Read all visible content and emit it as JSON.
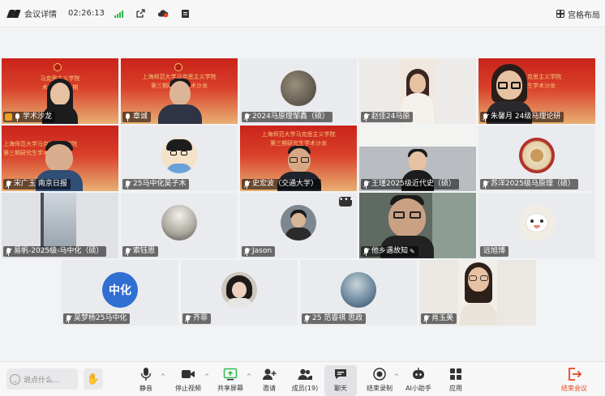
{
  "topbar": {
    "app_label": "会议详情",
    "timer": "02:26:13",
    "layout_label": "宫格布局"
  },
  "banner": {
    "lines": [
      "上海师范大学马克思主义学院",
      "第三期研究生学术沙龙"
    ],
    "fragment_1": [
      "马克思主义学院",
      "术沙龙(第三期"
    ],
    "fragment_4": [
      "克思主义学院",
      "生学术沙龙"
    ]
  },
  "participants": [
    {
      "name": "学术沙龙",
      "mic": "on",
      "host": true
    },
    {
      "name": "章诚",
      "mic": "on"
    },
    {
      "name": "2024马原理邹鑫（硕）",
      "mic": "off"
    },
    {
      "name": "赵佳24马原",
      "mic": "off"
    },
    {
      "name": "朱馨月 24级马理论研",
      "mic": "off"
    },
    {
      "name": "宋广玉 南京日报",
      "mic": "off"
    },
    {
      "name": "25马中化吴子木",
      "mic": "off"
    },
    {
      "name": "史宏波（交通大学）",
      "mic": "off"
    },
    {
      "name": "王瑾2025级近代史（硕）",
      "mic": "off"
    },
    {
      "name": "苏洋2025级马原理（硕）",
      "mic": "off"
    },
    {
      "name": "易帆-2025级-马中化（硕）",
      "mic": "off"
    },
    {
      "name": "索钰恩",
      "mic": "off"
    },
    {
      "name": "Jason",
      "mic": "off"
    },
    {
      "name": "他乡遇故知",
      "mic": "off"
    },
    {
      "name": "远旭博",
      "mic": "none"
    },
    {
      "name": "吴梦杨25马中化",
      "mic": "off",
      "avatar_text": "中化"
    },
    {
      "name": "齐菲",
      "mic": "off"
    },
    {
      "name": "25 范睿祺 思政",
      "mic": "off"
    },
    {
      "name": "肖玉美",
      "mic": "off"
    }
  ],
  "more_dots": "•••",
  "toolbar": {
    "say_placeholder": "说点什么...",
    "mute": "静音",
    "stop_video": "停止视频",
    "share_screen": "共享屏幕",
    "invite": "邀请",
    "members": "成员(19)",
    "chat": "聊天",
    "end_record": "结束录制",
    "ai_assistant": "AI小助手",
    "apps": "应用",
    "end_meeting": "结束会议"
  },
  "colors": {
    "banner_red": "#c9231a",
    "signal_green": "#2db84d",
    "end_orange": "#e8471b",
    "avatar_blue": "#2f6fd1"
  }
}
